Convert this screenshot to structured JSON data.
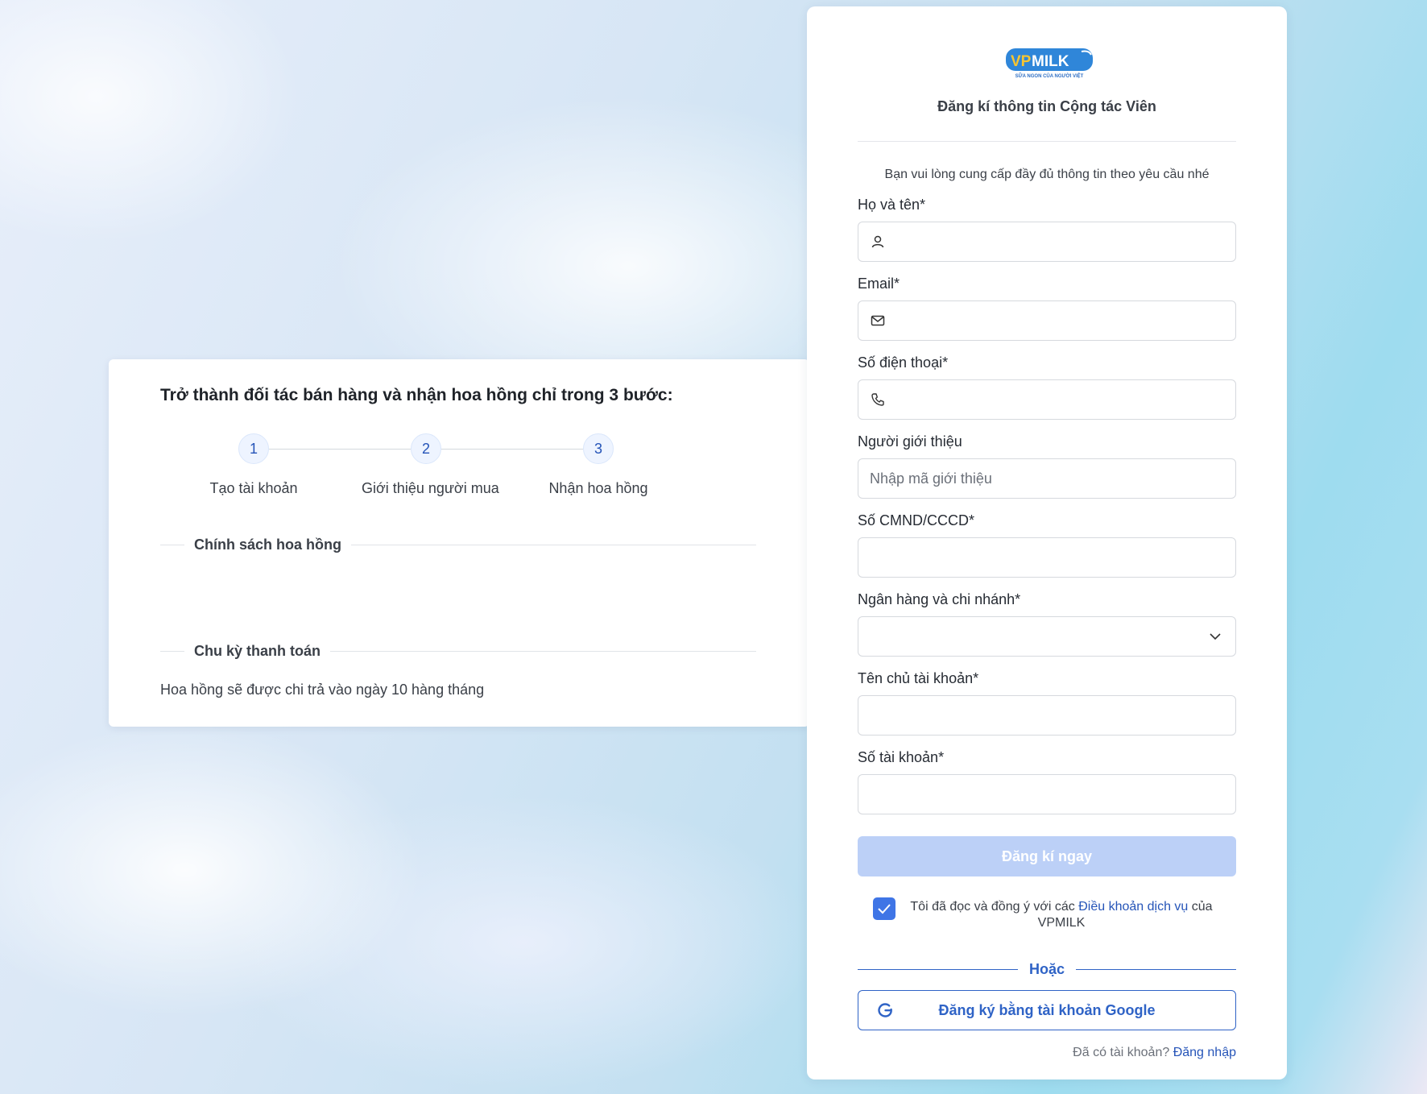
{
  "info": {
    "title": "Trở thành đối tác bán hàng và nhận hoa hồng chỉ trong 3 bước:",
    "steps": [
      {
        "number": "1",
        "label": "Tạo tài khoản"
      },
      {
        "number": "2",
        "label": "Giới thiệu người mua"
      },
      {
        "number": "3",
        "label": "Nhận hoa hồng"
      }
    ],
    "commission_policy_heading": "Chính sách hoa hồng",
    "payment_cycle_heading": "Chu kỳ thanh toán",
    "payment_note": "Hoa hồng sẽ được chi trả vào ngày 10 hàng tháng"
  },
  "form": {
    "logo_text": "VPMILK",
    "logo_tagline": "SỮA NGON CỦA NGƯỜI VIỆT",
    "title": "Đăng kí thông tin Cộng tác Viên",
    "hint": "Bạn vui lòng cung cấp đầy đủ thông tin theo yêu cầu nhé",
    "fields": {
      "full_name": {
        "label": "Họ và tên*",
        "value": "",
        "placeholder": "",
        "icon": "user-icon"
      },
      "email": {
        "label": "Email*",
        "value": "",
        "placeholder": "",
        "icon": "mail-icon"
      },
      "phone": {
        "label": "Số điện thoại*",
        "value": "",
        "placeholder": "",
        "icon": "phone-icon"
      },
      "referrer": {
        "label": "Người giới thiệu",
        "value": "",
        "placeholder": "Nhập mã giới thiệu"
      },
      "id_number": {
        "label": "Số CMND/CCCD*",
        "value": "",
        "placeholder": ""
      },
      "bank": {
        "label": "Ngân hàng và chi nhánh*",
        "value": "",
        "icon": "chevron-down-icon"
      },
      "account_holder": {
        "label": "Tên chủ tài khoản*",
        "value": "",
        "placeholder": ""
      },
      "account_number": {
        "label": "Số tài khoản*",
        "value": "",
        "placeholder": ""
      }
    },
    "submit_label": "Đăng kí ngay",
    "terms": {
      "checked": true,
      "prefix": "Tôi đã đọc và đồng ý với các ",
      "link": "Điều khoản dịch vụ",
      "suffix": " của VPMILK"
    },
    "or_label": "Hoặc",
    "google_label": "Đăng ký bằng tài khoản Google",
    "login_prompt": "Đã có tài khoản? ",
    "login_link": "Đăng nhập"
  },
  "colors": {
    "primary": "#2f63c6",
    "submit_disabled": "#bcd0f7",
    "checkbox": "#3f75e6"
  }
}
